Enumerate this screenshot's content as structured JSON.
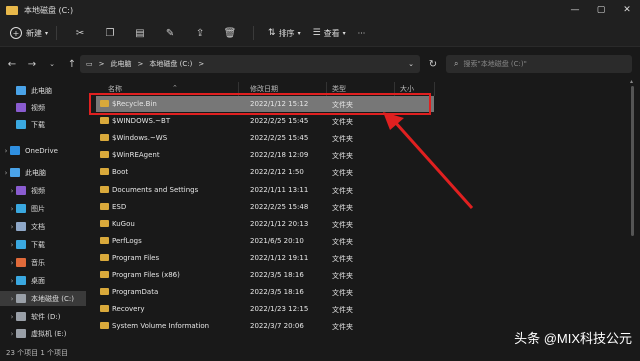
{
  "window": {
    "title": "本地磁盘 (C:)"
  },
  "toolbar": {
    "new_label": "新建",
    "sort_label": "排序",
    "view_label": "查看",
    "more": "···"
  },
  "address": {
    "seg1": "此电脑",
    "seg2": "本地磁盘 (C:)",
    "sep": ">"
  },
  "search": {
    "placeholder": "搜索\"本地磁盘 (C:)\""
  },
  "columns": {
    "name": "名称",
    "date": "修改日期",
    "type": "类型",
    "size": "大小"
  },
  "sidebar": {
    "items": [
      {
        "label": "此电脑",
        "icon": "pc-icon",
        "color": "#4aa3e8"
      },
      {
        "label": "视频",
        "icon": "video-icon",
        "color": "#8a5cd0"
      },
      {
        "label": "下载",
        "icon": "download-icon",
        "color": "#3aa8e0"
      },
      {
        "label": "OneDrive",
        "icon": "cloud-icon",
        "color": "#2f8fe0"
      },
      {
        "label": "此电脑",
        "icon": "pc-icon",
        "color": "#4aa3e8"
      },
      {
        "label": "视频",
        "icon": "video-icon",
        "color": "#8a5cd0"
      },
      {
        "label": "图片",
        "icon": "picture-icon",
        "color": "#3aa8e0"
      },
      {
        "label": "文档",
        "icon": "document-icon",
        "color": "#8fa8c8"
      },
      {
        "label": "下载",
        "icon": "download-icon",
        "color": "#3aa8e0"
      },
      {
        "label": "音乐",
        "icon": "music-icon",
        "color": "#e06a3a"
      },
      {
        "label": "桌面",
        "icon": "desktop-icon",
        "color": "#3aa8e0"
      },
      {
        "label": "本地磁盘 (C:)",
        "icon": "drive-icon",
        "color": "#9aa0a8"
      },
      {
        "label": "软件 (D:)",
        "icon": "drive-icon",
        "color": "#9aa0a8"
      },
      {
        "label": "虚拟机 (E:)",
        "icon": "drive-icon",
        "color": "#9aa0a8"
      }
    ]
  },
  "files": [
    {
      "name": "$Recycle.Bin",
      "date": "2022/1/12 15:12",
      "type": "文件夹"
    },
    {
      "name": "$WINDOWS.~BT",
      "date": "2022/2/25 15:45",
      "type": "文件夹"
    },
    {
      "name": "$Windows.~WS",
      "date": "2022/2/25 15:45",
      "type": "文件夹"
    },
    {
      "name": "$WinREAgent",
      "date": "2022/2/18 12:09",
      "type": "文件夹"
    },
    {
      "name": "Boot",
      "date": "2022/2/12 1:50",
      "type": "文件夹"
    },
    {
      "name": "Documents and Settings",
      "date": "2022/1/11 13:11",
      "type": "文件夹"
    },
    {
      "name": "ESD",
      "date": "2022/2/25 15:48",
      "type": "文件夹"
    },
    {
      "name": "KuGou",
      "date": "2022/1/12 20:13",
      "type": "文件夹"
    },
    {
      "name": "PerfLogs",
      "date": "2021/6/5 20:10",
      "type": "文件夹"
    },
    {
      "name": "Program Files",
      "date": "2022/1/12 19:11",
      "type": "文件夹"
    },
    {
      "name": "Program Files (x86)",
      "date": "2022/3/5 18:16",
      "type": "文件夹"
    },
    {
      "name": "ProgramData",
      "date": "2022/3/5 18:16",
      "type": "文件夹"
    },
    {
      "name": "Recovery",
      "date": "2022/1/23 12:15",
      "type": "文件夹"
    },
    {
      "name": "System Volume Information",
      "date": "2022/3/7 20:06",
      "type": "文件夹"
    }
  ],
  "status": {
    "count": "23 个项目   1 个项目"
  },
  "watermark": "头条 @MIX科技公元"
}
